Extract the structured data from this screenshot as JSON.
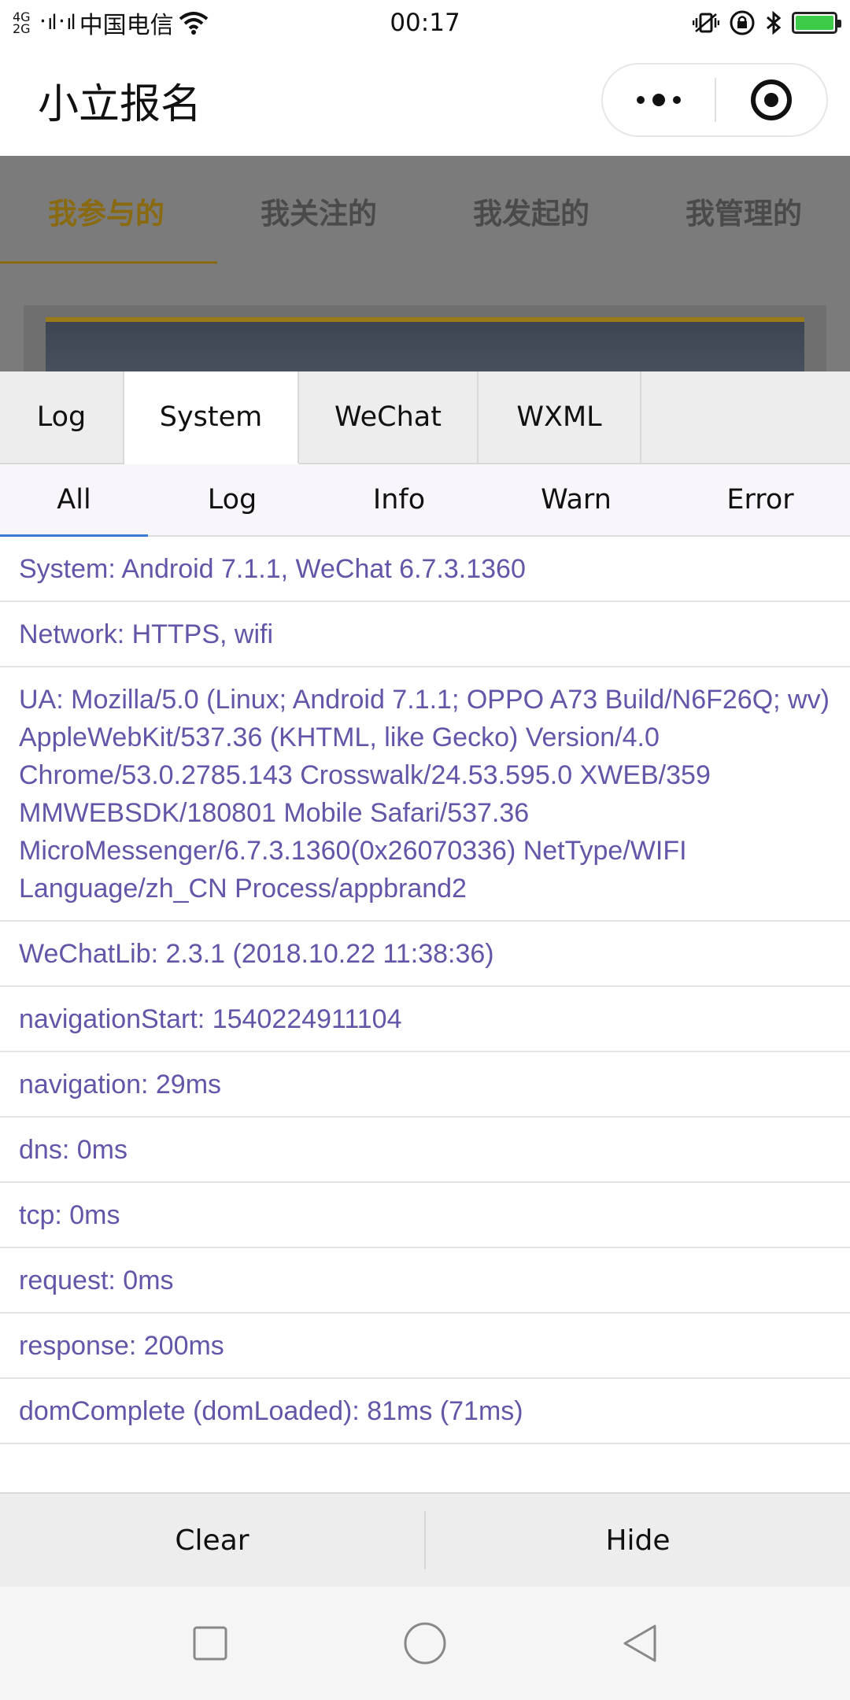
{
  "status_bar": {
    "network_top": "4G",
    "network_bottom": "2G",
    "signal": "᛫ıl᛫ıl",
    "carrier": "中国电信",
    "time": "00:17",
    "battery_color": "#3ecb4a"
  },
  "header": {
    "title": "小立报名"
  },
  "background_page": {
    "tabs": [
      "我参与的",
      "我关注的",
      "我发起的",
      "我管理的"
    ],
    "accent": "#8a6a10"
  },
  "console": {
    "main_tabs": [
      "Log",
      "System",
      "WeChat",
      "WXML"
    ],
    "active_main_tab": "System",
    "sub_tabs": [
      "All",
      "Log",
      "Info",
      "Warn",
      "Error"
    ],
    "active_sub_tab": "All",
    "log_color": "#6156a8",
    "logs": [
      "System: Android 7.1.1, WeChat 6.7.3.1360",
      "Network: HTTPS, wifi",
      "UA: Mozilla/5.0 (Linux; Android 7.1.1; OPPO A73 Build/N6F26Q; wv) AppleWebKit/537.36 (KHTML, like Gecko) Version/4.0 Chrome/53.0.2785.143 Crosswalk/24.53.595.0 XWEB/359 MMWEBSDK/180801 Mobile Safari/537.36 MicroMessenger/6.7.3.1360(0x26070336) NetType/WIFI Language/zh_CN Process/appbrand2",
      "WeChatLib: 2.3.1 (2018.10.22 11:38:36)",
      "navigationStart: 1540224911104",
      "navigation: 29ms",
      "dns: 0ms",
      "tcp: 0ms",
      "request: 0ms",
      "response: 200ms",
      "domComplete (domLoaded): 81ms (71ms)"
    ],
    "buttons": {
      "clear": "Clear",
      "hide": "Hide"
    }
  }
}
